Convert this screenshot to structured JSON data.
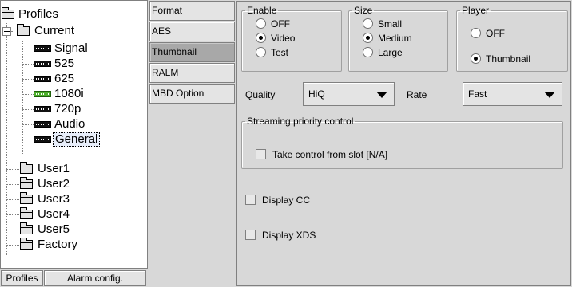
{
  "tree": {
    "root": "Profiles",
    "current": "Current",
    "current_items": [
      {
        "label": "Signal"
      },
      {
        "label": "525"
      },
      {
        "label": "625"
      },
      {
        "label": "1080i"
      },
      {
        "label": "720p"
      },
      {
        "label": "Audio"
      },
      {
        "label": "General"
      }
    ],
    "users": [
      "User1",
      "User2",
      "User3",
      "User4",
      "User5"
    ],
    "factory": "Factory"
  },
  "bottom_buttons": {
    "profiles": "Profiles",
    "alarm_config": "Alarm config."
  },
  "tabs": [
    "Format",
    "AES",
    "Thumbnail",
    "RALM",
    "MBD Option"
  ],
  "active_tab": "Thumbnail",
  "enable": {
    "legend": "Enable",
    "options": [
      "OFF",
      "Video",
      "Test"
    ],
    "selected": "Video"
  },
  "size": {
    "legend": "Size",
    "options": [
      "Small",
      "Medium",
      "Large"
    ],
    "selected": "Medium"
  },
  "player": {
    "legend": "Player",
    "options": [
      "OFF",
      "Thumbnail"
    ],
    "selected": "Thumbnail"
  },
  "quality": {
    "label": "Quality",
    "value": "HiQ"
  },
  "rate": {
    "label": "Rate",
    "value": "Fast"
  },
  "streaming": {
    "legend": "Streaming priority control",
    "checkbox_label": "Take control from slot [N/A]"
  },
  "display_cc": {
    "label": "Display CC"
  },
  "display_xds": {
    "label": "Display XDS"
  }
}
